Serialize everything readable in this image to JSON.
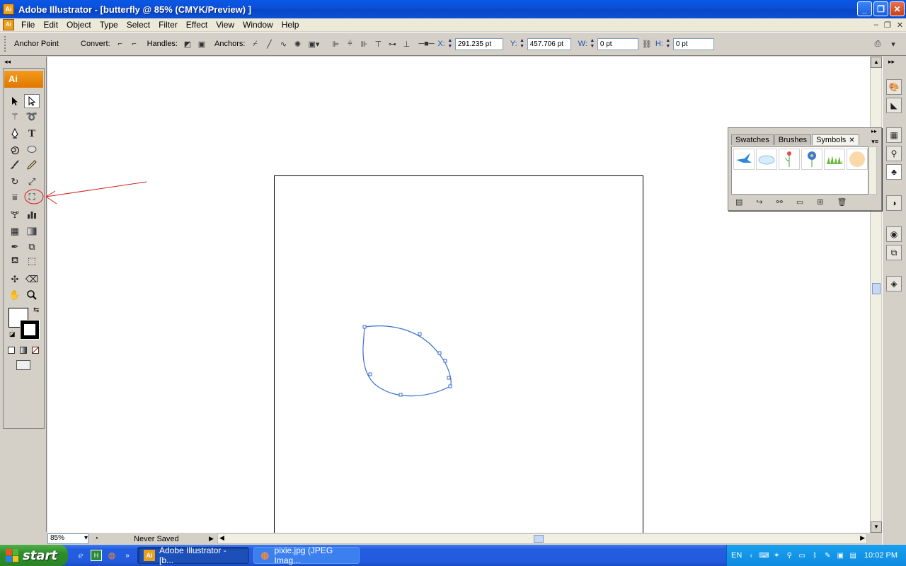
{
  "window": {
    "title": "Adobe Illustrator - [butterfly @ 85% (CMYK/Preview) ]",
    "app_icon": "Ai"
  },
  "menu": {
    "items": [
      "File",
      "Edit",
      "Object",
      "Type",
      "Select",
      "Filter",
      "Effect",
      "View",
      "Window",
      "Help"
    ]
  },
  "control_bar": {
    "context": "Anchor Point",
    "convert_label": "Convert:",
    "handles_label": "Handles:",
    "anchors_label": "Anchors:",
    "x_label": "X:",
    "x_value": "291.235 pt",
    "y_label": "Y:",
    "y_value": "457.706 pt",
    "w_label": "W:",
    "w_value": "0 pt",
    "h_label": "H:",
    "h_value": "0 pt"
  },
  "toolbox": {
    "logo": "Ai",
    "type_tool_glyph": "T"
  },
  "symbols_panel": {
    "tabs": [
      "Swatches",
      "Brushes",
      "Symbols"
    ],
    "active_tab": "Symbols",
    "symbols": [
      "bird-symbol",
      "cloud-symbol",
      "flower-stem-symbol",
      "blue-flower-symbol",
      "grass-symbol",
      "orange-blob-symbol"
    ]
  },
  "status": {
    "zoom": "85%",
    "save_state": "Never Saved"
  },
  "taskbar": {
    "start_label": "start",
    "items": [
      {
        "label": "Adobe Illustrator - [b...",
        "active": true
      },
      {
        "label": "pixie.jpg (JPEG Imag...",
        "active": false
      }
    ],
    "lang": "EN",
    "clock": "10:02 PM"
  },
  "colors": {
    "path_stroke": "#3a6fd0",
    "annotation_red": "#d02020",
    "ai_orange": "#f0901a"
  }
}
